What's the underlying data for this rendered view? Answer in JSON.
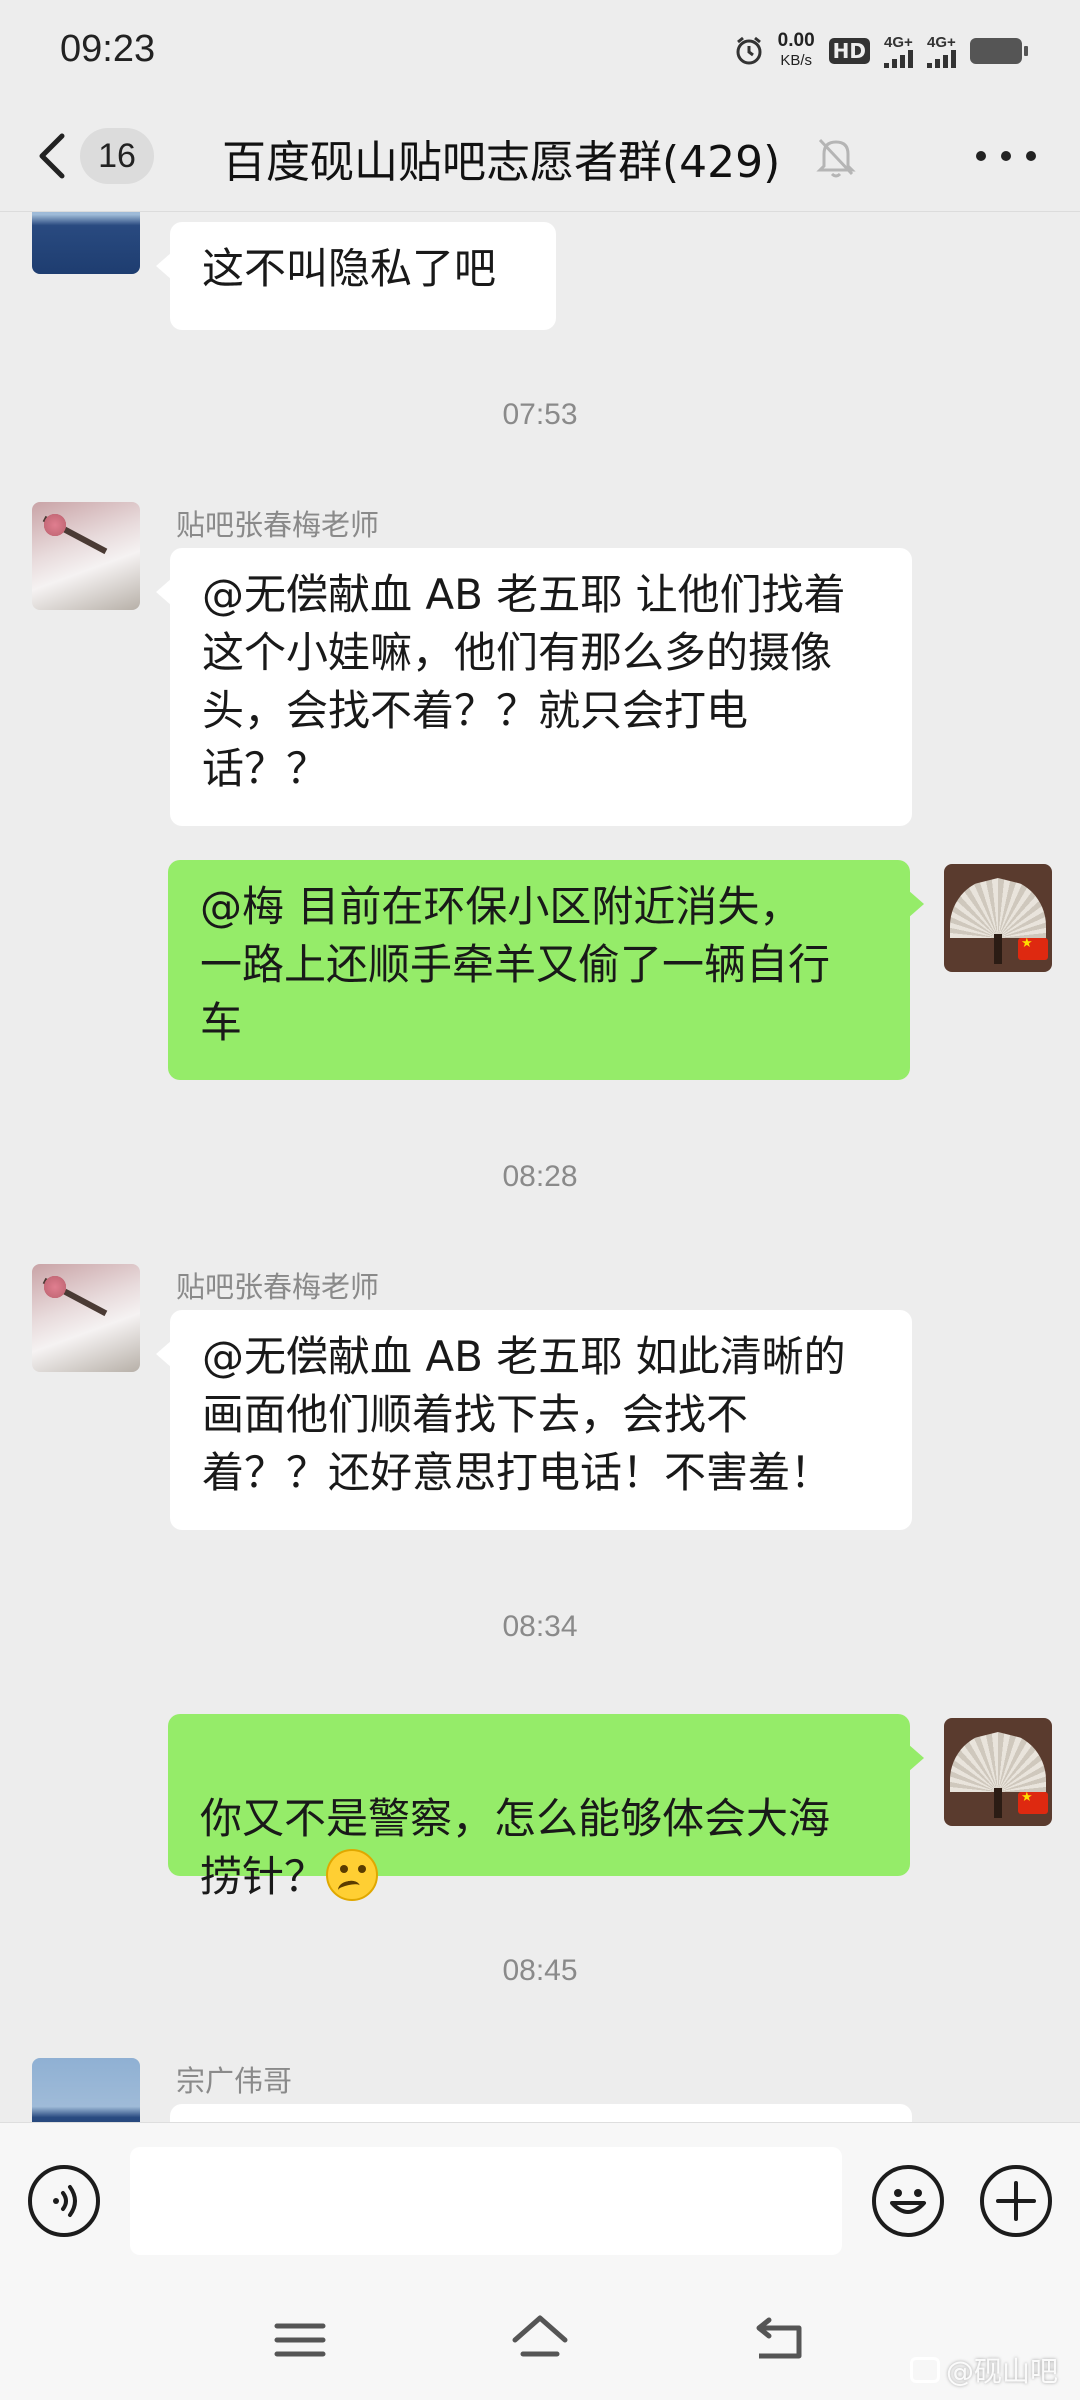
{
  "status_bar": {
    "time": "09:23",
    "net_speed_value": "0.00",
    "net_speed_unit": "KB/s",
    "hd_label": "HD",
    "signal_1_label": "4G+",
    "signal_2_label": "4G+"
  },
  "header": {
    "unread_count": "16",
    "title": "百度砚山贴吧志愿者群(429)"
  },
  "messages": {
    "m0": {
      "text": "这不叫隐私了吧"
    },
    "t1": "07:53",
    "m1": {
      "sender": "贴吧张春梅老师",
      "text": "@无偿献血 AB 老五耶  让他们找着\n这个小娃嘛，他们有那么多的摄像\n头，会找不着？？就只会打电\n话？？"
    },
    "m2": {
      "text": "@梅  目前在环保小区附近消失，\n一路上还顺手牵羊又偷了一辆自行\n车"
    },
    "t2": "08:28",
    "m3": {
      "sender": "贴吧张春梅老师",
      "text": "@无偿献血 AB 老五耶  如此清晰的\n画面他们顺着找下去，会找不\n着？？还好意思打电话！不害羞！"
    },
    "t3": "08:34",
    "m4": {
      "text": "你又不是警察，怎么能够体会大海\n捞针？",
      "emoji": "thinking-face"
    },
    "t4": "08:45",
    "m5": {
      "sender": "宗广伟哥"
    }
  },
  "input": {
    "placeholder": ""
  },
  "watermark": "@砚山吧",
  "colors": {
    "background": "#ededed",
    "bubble_out": "#95ec69",
    "bubble_in": "#ffffff"
  }
}
